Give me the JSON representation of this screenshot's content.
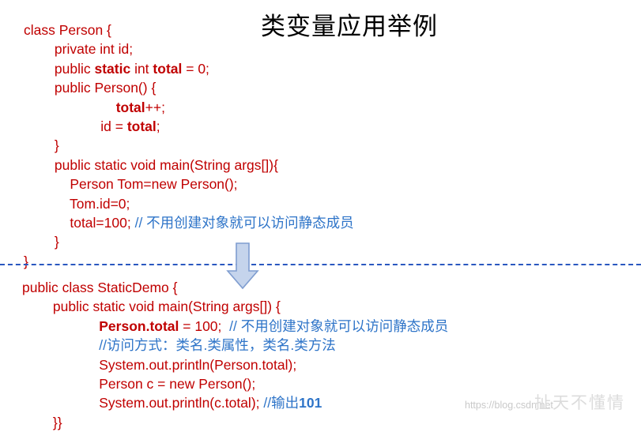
{
  "slide": {
    "title": "类变量应用举例",
    "code_color": "#c00000",
    "comment_color": "#2e74c8",
    "divider_color": "#2a58c0",
    "arrow_color": "#8faadc"
  },
  "top_code": {
    "lines": [
      [
        {
          "t": "class Person {",
          "s": "plain"
        }
      ],
      [
        {
          "t": "        private int id;",
          "s": "plain"
        }
      ],
      [
        {
          "t": "        public ",
          "s": "plain"
        },
        {
          "t": "static",
          "s": "bold"
        },
        {
          "t": " int ",
          "s": "plain"
        },
        {
          "t": "total",
          "s": "bold"
        },
        {
          "t": " = 0;",
          "s": "plain"
        }
      ],
      [
        {
          "t": "        public Person() {",
          "s": "plain"
        }
      ],
      [
        {
          "t": "                        ",
          "s": "plain"
        },
        {
          "t": "total",
          "s": "bold"
        },
        {
          "t": "++;",
          "s": "plain"
        }
      ],
      [
        {
          "t": "                    id = ",
          "s": "plain"
        },
        {
          "t": "total",
          "s": "bold"
        },
        {
          "t": ";",
          "s": "plain"
        }
      ],
      [
        {
          "t": "        }",
          "s": "plain"
        }
      ],
      [
        {
          "t": "        public static void main(String args[]){",
          "s": "plain"
        }
      ],
      [
        {
          "t": "            Person Tom=new Person();",
          "s": "plain"
        }
      ],
      [
        {
          "t": "            Tom.id=0;",
          "s": "plain"
        }
      ],
      [
        {
          "t": "            total=100; ",
          "s": "plain"
        },
        {
          "t": "// 不用创建对象就可以访问静态成员",
          "s": "comment"
        }
      ],
      [
        {
          "t": "        }",
          "s": "plain"
        }
      ],
      [
        {
          "t": "}",
          "s": "plain"
        }
      ]
    ]
  },
  "bottom_code": {
    "lines": [
      [
        {
          "t": "public class StaticDemo {",
          "s": "plain"
        }
      ],
      [
        {
          "t": "        public static void main(String args[]) {",
          "s": "plain"
        }
      ],
      [
        {
          "t": "                    ",
          "s": "plain"
        },
        {
          "t": "Person.total",
          "s": "bold"
        },
        {
          "t": " = 100;  ",
          "s": "plain"
        },
        {
          "t": "// 不用创建对象就可以访问静态成员",
          "s": "comment"
        }
      ],
      [
        {
          "t": "                    ",
          "s": "plain"
        },
        {
          "t": "//访问方式：类名.类属性，类名.类方法",
          "s": "comment"
        }
      ],
      [
        {
          "t": "                    System.out.println(Person.total);",
          "s": "plain"
        }
      ],
      [
        {
          "t": "                    Person c = new Person();",
          "s": "plain"
        }
      ],
      [
        {
          "t": "                    System.out.println(c.total); ",
          "s": "plain"
        },
        {
          "t": "//输出",
          "s": "comment"
        },
        {
          "t": "101",
          "s": "comment-bold"
        }
      ],
      [
        {
          "t": "        }}",
          "s": "plain"
        }
      ]
    ]
  },
  "watermark": {
    "url": "https://blog.csdn.net",
    "text": "扯天不懂情"
  }
}
